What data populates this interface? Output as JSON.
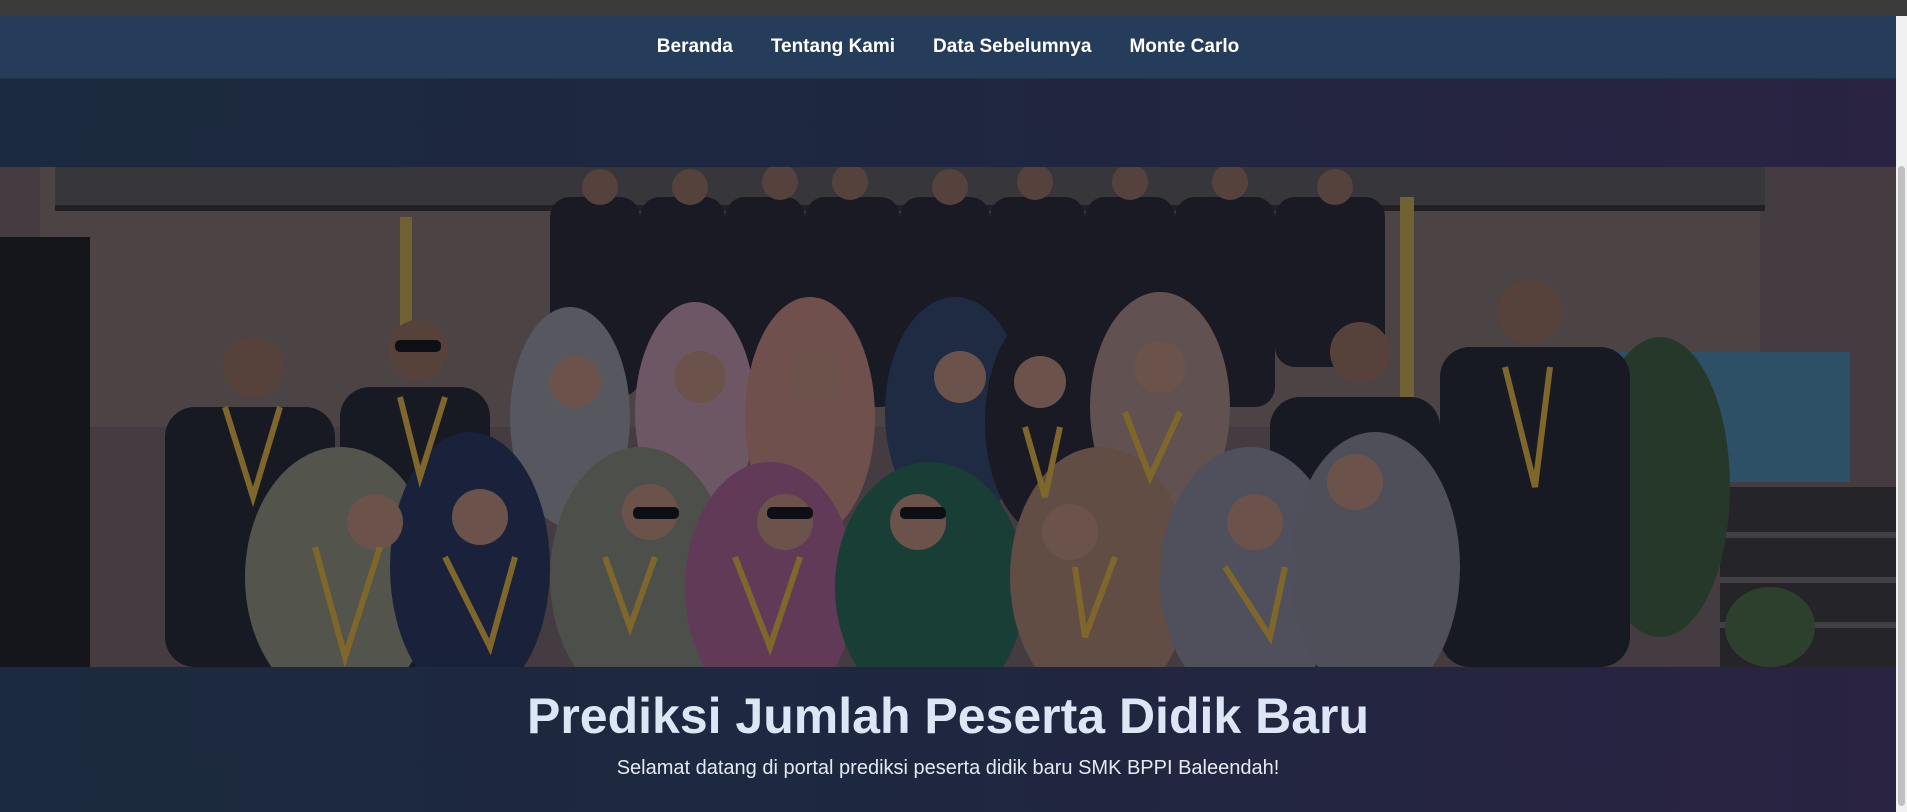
{
  "nav": {
    "items": [
      {
        "label": "Beranda"
      },
      {
        "label": "Tentang Kami"
      },
      {
        "label": "Data Sebelumnya"
      },
      {
        "label": "Monte Carlo"
      }
    ]
  },
  "hero": {
    "image_alt": "group-photo",
    "title": "Prediksi Jumlah Peserta Didik Baru",
    "subtitle": "Selamat datang di portal prediksi peserta didik baru SMK BPPI Baleendah!"
  },
  "colors": {
    "navbar": "#253d5b",
    "page_background_start": "#1b2a3e",
    "page_background_end": "#2a2342",
    "title_text": "#dce6f5"
  }
}
